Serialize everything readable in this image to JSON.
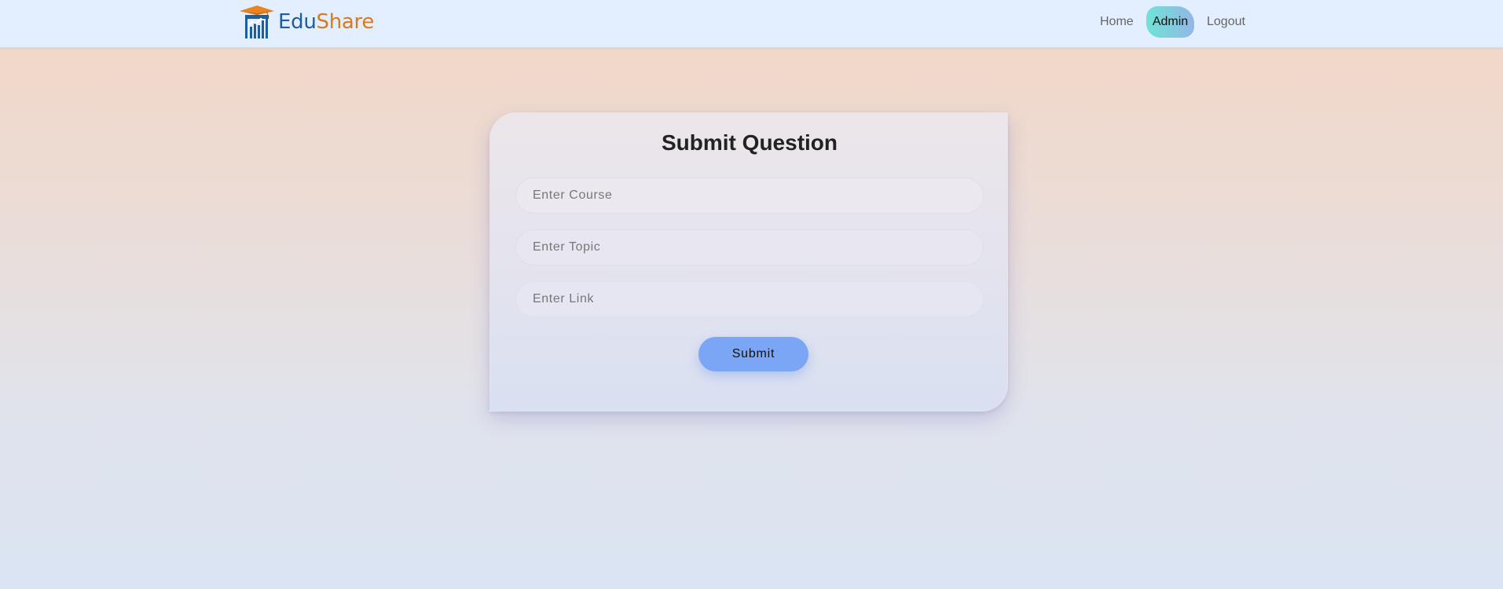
{
  "brand": {
    "name_part1": "Edu",
    "name_part2": "Share",
    "logo_icon": "graduation-cap-chart-logo",
    "colors": {
      "primary": "#1f5e9c",
      "accent": "#d97a1e"
    }
  },
  "nav": {
    "links": [
      {
        "label": "Home",
        "active": false
      },
      {
        "label": "Admin",
        "active": true
      },
      {
        "label": "Logout",
        "active": false
      }
    ]
  },
  "form": {
    "title": "Submit Question",
    "course": {
      "value": "",
      "placeholder": "Enter Course"
    },
    "topic": {
      "value": "",
      "placeholder": "Enter Topic"
    },
    "link": {
      "value": "",
      "placeholder": "Enter Link"
    },
    "submit_label": "Submit"
  },
  "colors": {
    "nav_bg": "#e3efff",
    "button": "#7aa6f5",
    "active_tab_start": "#6fe3d6",
    "active_tab_end": "#93b6e6"
  }
}
